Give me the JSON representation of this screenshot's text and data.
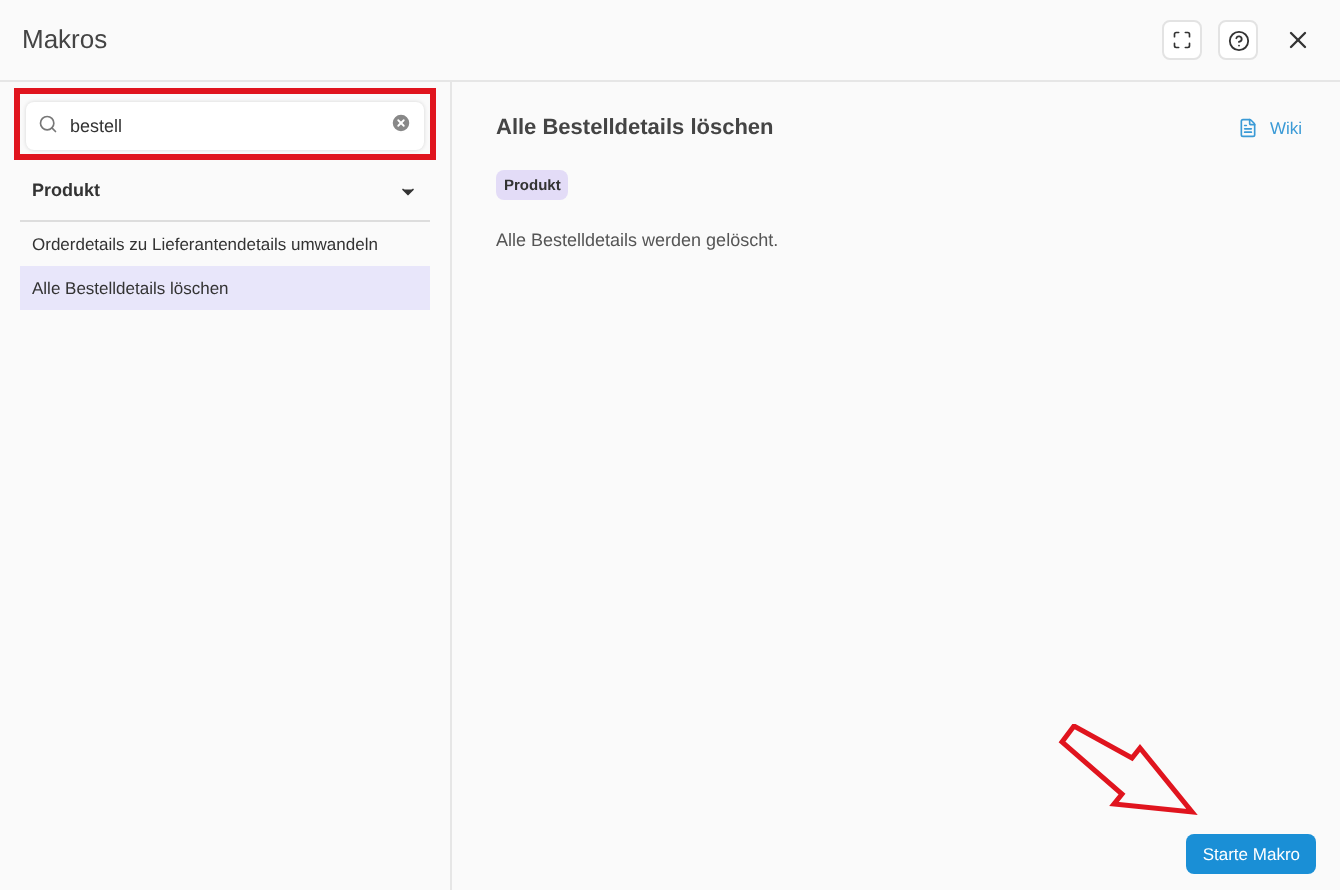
{
  "window": {
    "title": "Makros"
  },
  "search": {
    "value": "bestell",
    "highlighted": true
  },
  "group": {
    "label": "Produkt",
    "expanded": true
  },
  "items": [
    {
      "label": "Orderdetails zu Lieferantendetails umwandeln",
      "selected": false
    },
    {
      "label": "Alle Bestelldetails löschen",
      "selected": true
    }
  ],
  "detail": {
    "title": "Alle Bestelldetails löschen",
    "link": "Wiki",
    "tag": "Produkt",
    "description": "Alle Bestelldetails werden gelöscht."
  },
  "primary_button": "Starte Makro"
}
